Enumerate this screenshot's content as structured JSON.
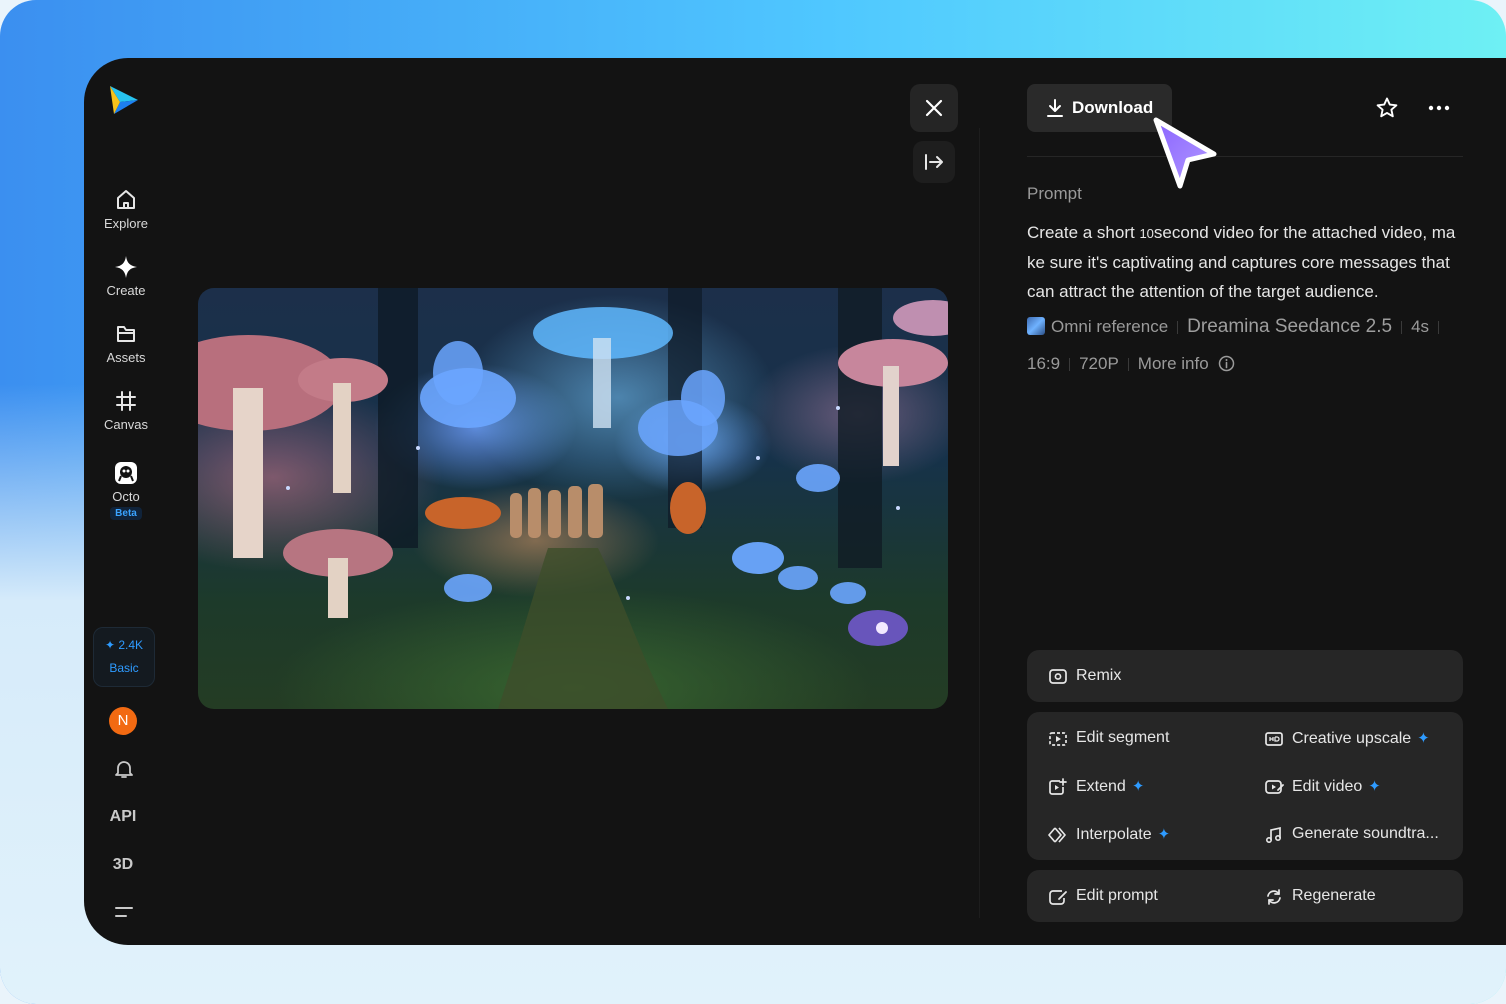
{
  "sidebar": {
    "items": [
      {
        "label": "Explore",
        "icon": "home-icon"
      },
      {
        "label": "Create",
        "icon": "sparkle-icon"
      },
      {
        "label": "Assets",
        "icon": "folder-icon"
      },
      {
        "label": "Canvas",
        "icon": "canvas-icon"
      },
      {
        "label": "Octo",
        "icon": "octo-icon",
        "badge": "Beta"
      }
    ],
    "credits": {
      "amount": "2.4K",
      "plan": "Basic"
    },
    "avatar_initial": "N",
    "api_label": "API",
    "threed_label": "3D"
  },
  "toolbar": {
    "download_label": "Download"
  },
  "prompt": {
    "label": "Prompt",
    "text_a": "Create a short ",
    "text_num": "10",
    "text_b": "second video for the attached video, make sure it's captivating and captures core messages that can attract the attention of the target audience."
  },
  "meta": {
    "reference": "Omni reference",
    "model": "Dreamina Seedance 2.5",
    "duration": "4s",
    "ratio": "16:9",
    "resolution": "720P",
    "more_info": "More info"
  },
  "actions": {
    "remix": "Remix",
    "edit_segment": "Edit segment",
    "creative_upscale": "Creative upscale",
    "extend": "Extend",
    "edit_video": "Edit video",
    "interpolate": "Interpolate",
    "generate_soundtrack": "Generate soundtra...",
    "edit_prompt": "Edit prompt",
    "regenerate": "Regenerate"
  },
  "colors": {
    "accent": "#2e9bff",
    "avatar": "#f26a12",
    "cursor": "#9b7bff"
  }
}
